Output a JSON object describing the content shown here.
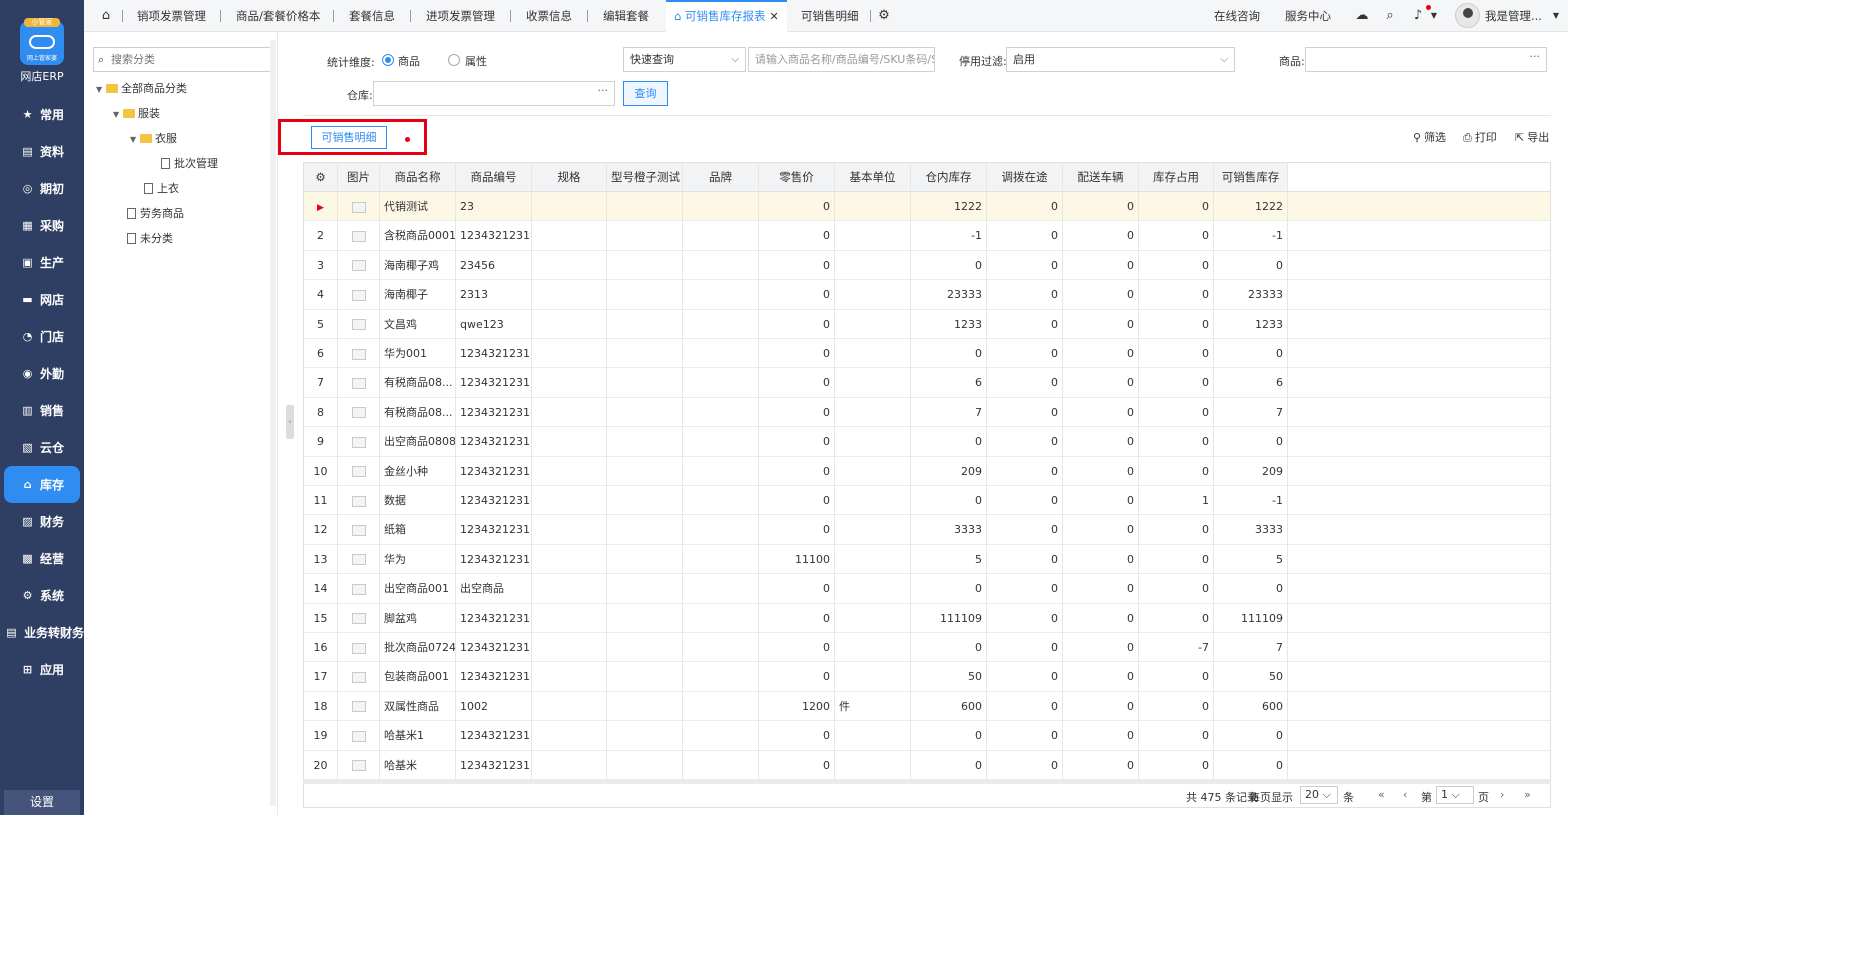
{
  "app": {
    "logo_badge": "小管家",
    "logo_sub": "网上管家婆",
    "name": "网店ERP"
  },
  "sidebar": {
    "items": [
      {
        "label": "常用",
        "icon": "star-icon",
        "glyph": "★"
      },
      {
        "label": "资料",
        "icon": "document-icon",
        "glyph": "▤"
      },
      {
        "label": "期初",
        "icon": "target-icon",
        "glyph": "◎"
      },
      {
        "label": "采购",
        "icon": "purchase-icon",
        "glyph": "▦"
      },
      {
        "label": "生产",
        "icon": "production-icon",
        "glyph": "▣"
      },
      {
        "label": "网店",
        "icon": "shop-icon",
        "glyph": "▬"
      },
      {
        "label": "门店",
        "icon": "store-chart-icon",
        "glyph": "◔"
      },
      {
        "label": "外勤",
        "icon": "field-work-icon",
        "glyph": "◉"
      },
      {
        "label": "销售",
        "icon": "sales-icon",
        "glyph": "▥"
      },
      {
        "label": "云仓",
        "icon": "cloud-warehouse-icon",
        "glyph": "▧"
      },
      {
        "label": "库存",
        "icon": "home-icon",
        "glyph": "⌂"
      },
      {
        "label": "财务",
        "icon": "finance-icon",
        "glyph": "▨"
      },
      {
        "label": "经营",
        "icon": "business-icon",
        "glyph": "▩"
      },
      {
        "label": "系统",
        "icon": "system-gear-icon",
        "glyph": "⚙"
      },
      {
        "label": "业务转财务",
        "icon": "transfer-icon",
        "glyph": "▤"
      },
      {
        "label": "应用",
        "icon": "plus-square-icon",
        "glyph": "⊞"
      }
    ],
    "active_index": 10,
    "settings": "设置"
  },
  "topbar": {
    "tabs": [
      "销项发票管理",
      "商品/套餐价格本",
      "套餐信息",
      "进项发票管理",
      "收票信息",
      "编辑套餐",
      "可销售库存报表",
      "可销售明细"
    ],
    "active_tab": "可销售库存报表",
    "close_glyph": "✕",
    "online_consult": "在线咨询",
    "service_center": "服务中心",
    "user_name": "我是管理..."
  },
  "tree": {
    "search_placeholder": "搜索分类",
    "nodes": [
      {
        "label": "全部商品分类"
      },
      {
        "label": "服装"
      },
      {
        "label": "衣服"
      },
      {
        "label": "批次管理"
      },
      {
        "label": "上衣"
      },
      {
        "label": "劳务商品"
      },
      {
        "label": "未分类"
      }
    ]
  },
  "filters": {
    "dimension_label": "统计维度:",
    "dim_goods": "商品",
    "dim_attr": "属性",
    "quick_query": "快速查询",
    "search_placeholder": "请输入商品名称/商品编号/SKU条码/S...",
    "disable_filter_label": "停用过滤:",
    "disable_filter_value": "启用",
    "goods_label": "商品:",
    "warehouse_label": "仓库:",
    "query_button": "查询",
    "dots": "···"
  },
  "toolbar": {
    "detail_button": "可销售明细",
    "filter": "筛选",
    "print": "打印",
    "export": "导出"
  },
  "table": {
    "headers": [
      "图片",
      "商品名称",
      "商品编号",
      "规格",
      "型号橙子测试",
      "品牌",
      "零售价",
      "基本单位",
      "仓内库存",
      "调拨在途",
      "配送车辆",
      "库存占用",
      "可销售库存"
    ],
    "rows": [
      [
        "",
        "代销测试",
        "23",
        "",
        "",
        "",
        "0",
        "",
        "1222",
        "0",
        "0",
        "0",
        "1222"
      ],
      [
        "2",
        "含税商品0001",
        "1234321231...",
        "",
        "",
        "",
        "0",
        "",
        "-1",
        "0",
        "0",
        "0",
        "-1"
      ],
      [
        "3",
        "海南椰子鸡",
        "23456",
        "",
        "",
        "",
        "0",
        "",
        "0",
        "0",
        "0",
        "0",
        "0"
      ],
      [
        "4",
        "海南椰子",
        "2313",
        "",
        "",
        "",
        "0",
        "",
        "23333",
        "0",
        "0",
        "0",
        "23333"
      ],
      [
        "5",
        "文昌鸡",
        "qwe123",
        "",
        "",
        "",
        "0",
        "",
        "1233",
        "0",
        "0",
        "0",
        "1233"
      ],
      [
        "6",
        "华为001",
        "1234321231...",
        "",
        "",
        "",
        "0",
        "",
        "0",
        "0",
        "0",
        "0",
        "0"
      ],
      [
        "7",
        "有税商品08...",
        "1234321231...",
        "",
        "",
        "",
        "0",
        "",
        "6",
        "0",
        "0",
        "0",
        "6"
      ],
      [
        "8",
        "有税商品08...",
        "1234321231...",
        "",
        "",
        "",
        "0",
        "",
        "7",
        "0",
        "0",
        "0",
        "7"
      ],
      [
        "9",
        "出空商品0808",
        "1234321231...",
        "",
        "",
        "",
        "0",
        "",
        "0",
        "0",
        "0",
        "0",
        "0"
      ],
      [
        "10",
        "金丝小种",
        "1234321231...",
        "",
        "",
        "",
        "0",
        "",
        "209",
        "0",
        "0",
        "0",
        "209"
      ],
      [
        "11",
        "数据",
        "1234321231...",
        "",
        "",
        "",
        "0",
        "",
        "0",
        "0",
        "0",
        "1",
        "-1"
      ],
      [
        "12",
        "纸箱",
        "1234321231...",
        "",
        "",
        "",
        "0",
        "",
        "3333",
        "0",
        "0",
        "0",
        "3333"
      ],
      [
        "13",
        "华为",
        "1234321231...",
        "",
        "",
        "",
        "11100",
        "",
        "5",
        "0",
        "0",
        "0",
        "5"
      ],
      [
        "14",
        "出空商品001",
        "出空商品",
        "",
        "",
        "",
        "0",
        "",
        "0",
        "0",
        "0",
        "0",
        "0"
      ],
      [
        "15",
        "脚盆鸡",
        "1234321231...",
        "",
        "",
        "",
        "0",
        "",
        "111109",
        "0",
        "0",
        "0",
        "111109"
      ],
      [
        "16",
        "批次商品0724",
        "1234321231...",
        "",
        "",
        "",
        "0",
        "",
        "0",
        "0",
        "0",
        "-7",
        "7"
      ],
      [
        "17",
        "包装商品001",
        "1234321231...",
        "",
        "",
        "",
        "0",
        "",
        "50",
        "0",
        "0",
        "0",
        "50"
      ],
      [
        "18",
        "双属性商品",
        "1002",
        "",
        "",
        "",
        "1200",
        "件",
        "600",
        "0",
        "0",
        "0",
        "600"
      ],
      [
        "19",
        "哈基米1",
        "1234321231...",
        "",
        "",
        "",
        "0",
        "",
        "0",
        "0",
        "0",
        "0",
        "0"
      ],
      [
        "20",
        "哈基米",
        "1234321231...",
        "",
        "",
        "",
        "0",
        "",
        "0",
        "0",
        "0",
        "0",
        "0"
      ]
    ],
    "selected_row": 0
  },
  "pager": {
    "summary": "共 475 条记录",
    "per_page_label": "每页显示",
    "per_page": "20",
    "unit": "条",
    "page_prefix": "第",
    "page": "1",
    "page_suffix": "页"
  }
}
